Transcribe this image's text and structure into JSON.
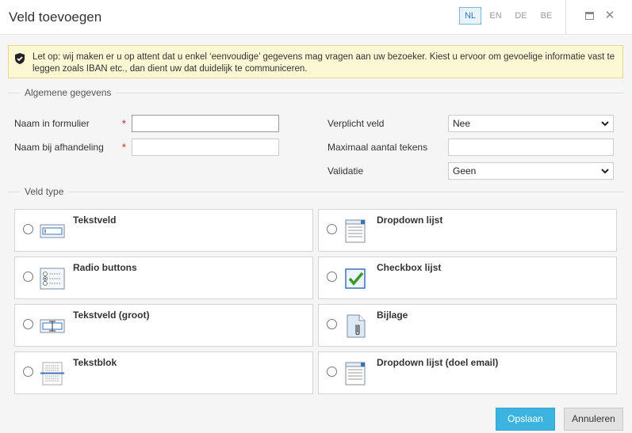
{
  "dialog": {
    "title": "Veld toevoegen",
    "languages": [
      "NL",
      "EN",
      "DE",
      "BE"
    ],
    "active_language": "NL",
    "maximize_icon": "maximize-icon",
    "close_icon": "close-icon"
  },
  "notice": {
    "icon": "shield-check-icon",
    "text": "Let op: wij maken er u op attent dat u enkel ‘eenvoudige’ gegevens mag vragen aan uw bezoeker. Kiest u ervoor om gevoelige informatie vast te leggen zoals IBAN etc., dan dient uw dat duidelijk te communiceren."
  },
  "general": {
    "section_label": "Algemene gegevens",
    "name_in_form_label": "Naam in formulier",
    "name_in_form_value": "",
    "name_in_handling_label": "Naam bij afhandeling",
    "name_in_handling_value": "",
    "required_marker": "*",
    "required_field_label": "Verplicht veld",
    "required_field_value": "Nee",
    "max_chars_label": "Maximaal aantal tekens",
    "max_chars_value": "",
    "validation_label": "Validatie",
    "validation_value": "Geen"
  },
  "field_type": {
    "section_label": "Veld type",
    "options": [
      {
        "label": "Tekstveld",
        "icon": "textfield-icon"
      },
      {
        "label": "Dropdown lijst",
        "icon": "dropdown-list-icon"
      },
      {
        "label": "Radio buttons",
        "icon": "radio-buttons-icon"
      },
      {
        "label": "Checkbox lijst",
        "icon": "checkbox-list-icon"
      },
      {
        "label": "Tekstveld (groot)",
        "icon": "textarea-icon"
      },
      {
        "label": "Bijlage",
        "icon": "attachment-icon"
      },
      {
        "label": "Tekstblok",
        "icon": "textblock-icon"
      },
      {
        "label": "Dropdown lijst (doel email)",
        "icon": "dropdown-email-icon"
      }
    ]
  },
  "footer": {
    "save_label": "Opslaan",
    "cancel_label": "Annuleren"
  },
  "colors": {
    "accent": "#3db4e0",
    "notice_bg": "#fcf8d4",
    "required": "#d9534f"
  }
}
